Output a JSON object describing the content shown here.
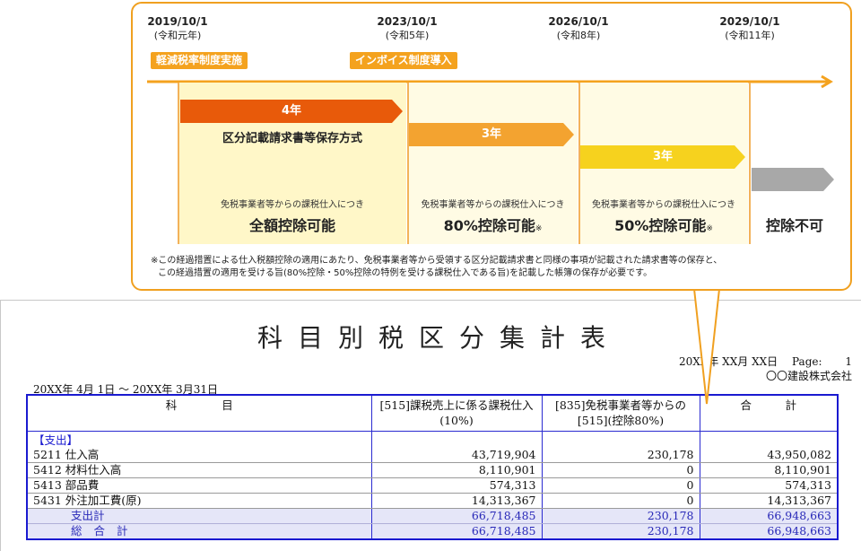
{
  "report": {
    "title": "科目別税区分集計表",
    "meta_line1_date": "20XX年 XX月 XX日",
    "page_label": "Page:",
    "page_number": "1",
    "company": "〇〇建設株式会社",
    "period": "20XX年 4月 1日 〜 20XX年 3月31日",
    "columns": [
      "科　　　　目",
      "[515]課税売上に係る課税仕入(10%)",
      "[835]免税事業者等からの[515](控除80%)",
      "合　　　計"
    ],
    "section_label": "【支出】",
    "rows": [
      {
        "code": "5211",
        "name": "仕入高",
        "taxable": "43,719,904",
        "exempt": "230,178",
        "total": "43,950,082"
      },
      {
        "code": "5412",
        "name": "材料仕入高",
        "taxable": "8,110,901",
        "exempt": "0",
        "total": "8,110,901"
      },
      {
        "code": "5413",
        "name": "部品費",
        "taxable": "574,313",
        "exempt": "0",
        "total": "574,313"
      },
      {
        "code": "5431",
        "name": "外注加工費(原)",
        "taxable": "14,313,367",
        "exempt": "0",
        "total": "14,313,367"
      }
    ],
    "subtotal": {
      "label": "支出計",
      "taxable": "66,718,485",
      "exempt": "230,178",
      "total": "66,948,663"
    },
    "grand_total": {
      "label": "総合計",
      "taxable": "66,718,485",
      "exempt": "230,178",
      "total": "66,948,663"
    }
  },
  "callout": {
    "dates": [
      {
        "date": "2019/10/1",
        "era": "(令和元年)"
      },
      {
        "date": "2023/10/1",
        "era": "(令和5年)"
      },
      {
        "date": "2026/10/1",
        "era": "(令和8年)"
      },
      {
        "date": "2029/10/1",
        "era": "(令和11年)"
      }
    ],
    "tags": [
      "軽減税率制度実施",
      "インボイス制度導入"
    ],
    "periods": [
      "4年",
      "3年",
      "3年"
    ],
    "method": "区分記載請求書等保存方式",
    "note": "免税事業者等からの課税仕入につき",
    "results": [
      "全額控除可能",
      "80%控除可能",
      "50%控除可能",
      "控除不可"
    ],
    "result_mark": "※",
    "footnote_line1": "※この経過措置による仕入税額控除の適用にあたり、免税事業者等から受領する区分記載請求書と同様の事項が記載された請求書等の保存と、",
    "footnote_line2": "この経過措置の適用を受ける旨(80%控除・50%控除の特例を受ける課税仕入である旨)を記載した帳簿の保存が必要です。"
  },
  "colors": {
    "accent_orange": "#f4a21e",
    "deep_orange": "#e85a0a",
    "yellow": "#f6d21e",
    "table_blue": "#1a1ad0"
  }
}
